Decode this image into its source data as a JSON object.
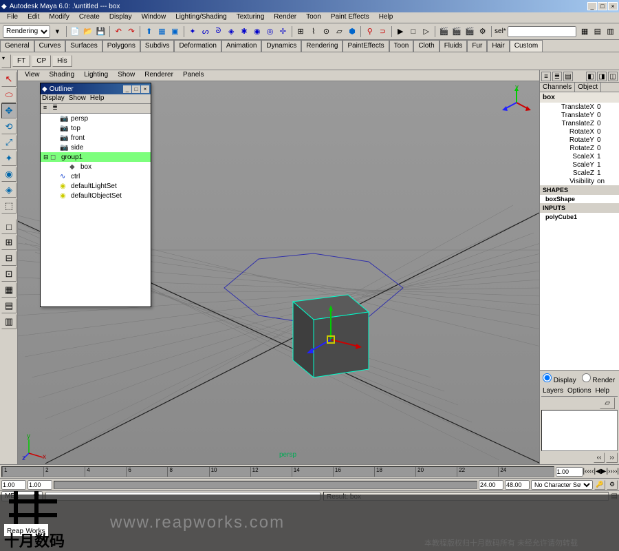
{
  "title": "Autodesk Maya 6.0: .\\untitled --- box",
  "menubar": [
    "File",
    "Edit",
    "Modify",
    "Create",
    "Display",
    "Window",
    "Lighting/Shading",
    "Texturing",
    "Render",
    "Toon",
    "Paint Effects",
    "Help"
  ],
  "moduleDropdown": "Rendering",
  "selField": "sel*",
  "shelfTabs": [
    "General",
    "Curves",
    "Surfaces",
    "Polygons",
    "Subdivs",
    "Deformation",
    "Animation",
    "Dynamics",
    "Rendering",
    "PaintEffects",
    "Toon",
    "Cloth",
    "Fluids",
    "Fur",
    "Hair",
    "Custom"
  ],
  "shelfActive": "Custom",
  "shelfButtons": [
    "FT",
    "CP",
    "His"
  ],
  "viewportMenu": [
    "View",
    "Shading",
    "Lighting",
    "Show",
    "Renderer",
    "Panels"
  ],
  "viewportCam": "persp",
  "outliner": {
    "title": "Outliner",
    "menu": [
      "Display",
      "Show",
      "Help"
    ],
    "items": [
      {
        "label": "persp",
        "indent": 1,
        "icon": "📷"
      },
      {
        "label": "top",
        "indent": 1,
        "icon": "📷"
      },
      {
        "label": "front",
        "indent": 1,
        "icon": "📷"
      },
      {
        "label": "side",
        "indent": 1,
        "icon": "📷"
      },
      {
        "label": "group1",
        "indent": 0,
        "icon": "◻",
        "exp": "⊟",
        "sel": true
      },
      {
        "label": "box",
        "indent": 2,
        "icon": "◆",
        "line": true
      },
      {
        "label": "ctrl",
        "indent": 1,
        "icon": "∿",
        "color": "#0033cc"
      },
      {
        "label": "defaultLightSet",
        "indent": 1,
        "icon": "◉",
        "color": "#cccc00"
      },
      {
        "label": "defaultObjectSet",
        "indent": 1,
        "icon": "◉",
        "color": "#cccc00"
      }
    ]
  },
  "channelBox": {
    "tabs": [
      "Channels",
      "Object"
    ],
    "object": "box",
    "attrs": [
      {
        "name": "TranslateX",
        "val": "0"
      },
      {
        "name": "TranslateY",
        "val": "0"
      },
      {
        "name": "TranslateZ",
        "val": "0"
      },
      {
        "name": "RotateX",
        "val": "0"
      },
      {
        "name": "RotateY",
        "val": "0"
      },
      {
        "name": "RotateZ",
        "val": "0"
      },
      {
        "name": "ScaleX",
        "val": "1"
      },
      {
        "name": "ScaleY",
        "val": "1"
      },
      {
        "name": "ScaleZ",
        "val": "1"
      },
      {
        "name": "Visibility",
        "val": "on"
      }
    ],
    "shapes": "SHAPES",
    "shapeName": "boxShape",
    "inputs": "INPUTS",
    "inputName": "polyCube1"
  },
  "layerPanel": {
    "displayRadio": "Display",
    "renderRadio": "Render",
    "menu": [
      "Layers",
      "Options",
      "Help"
    ]
  },
  "timeline": {
    "ticks": [
      "1",
      "2",
      "4",
      "6",
      "8",
      "10",
      "12",
      "14",
      "16",
      "18",
      "20",
      "22",
      "24"
    ],
    "startField": "1.00",
    "playStart": "1.00",
    "playEnd": "24.00",
    "endField": "48.00",
    "charSet": "No Character Set"
  },
  "cmdline": {
    "result": "Result: box"
  },
  "watermark": {
    "logo1": "Reap",
    "logo2": "Works",
    "cn": "十月数码",
    "url": "www.reapworks.com",
    "copyright": "本教程版权归十月数码所有 未经允许请勿转载"
  }
}
